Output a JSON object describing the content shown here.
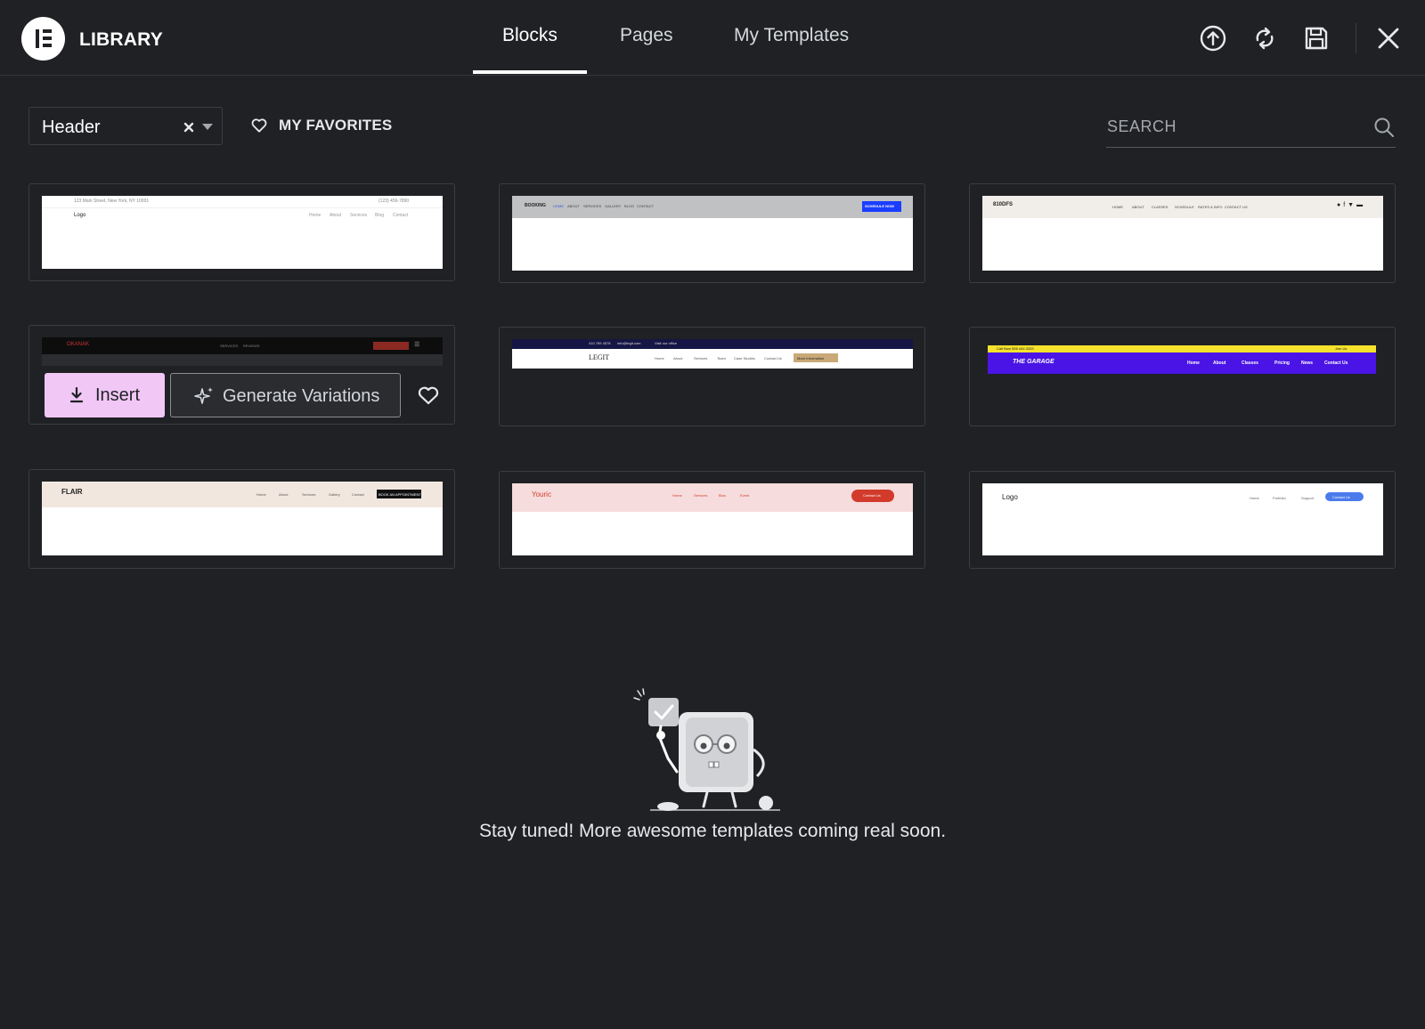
{
  "header": {
    "title": "LIBRARY",
    "tabs": [
      {
        "label": "Blocks",
        "active": true
      },
      {
        "label": "Pages",
        "active": false
      },
      {
        "label": "My Templates",
        "active": false
      }
    ],
    "icons": [
      "upload-icon",
      "sync-icon",
      "save-icon",
      "close-icon"
    ]
  },
  "filters": {
    "category_value": "Header",
    "favorites_label": "MY FAVORITES",
    "search_placeholder": "SEARCH"
  },
  "hovered_card": {
    "insert_label": "Insert",
    "generate_label": "Generate Variations"
  },
  "thumbnails": {
    "t1": {
      "top_text": "123 Main Street, New York, NY 10001",
      "phone": "(123) 456-7890",
      "logo": "Logo",
      "nav": [
        "Home",
        "About",
        "Services",
        "Blog",
        "Contact"
      ]
    },
    "t2": {
      "logo": "BOOKING",
      "nav": [
        "HOME",
        "ABOUT",
        "SERVICES",
        "GALLERY",
        "BLOG",
        "CONTACT"
      ],
      "cta": "SCHEDULE NOW"
    },
    "t3": {
      "logo": "810DFS",
      "nav": [
        "HOME",
        "ABOUT",
        "CLASSES",
        "SCHEDULE",
        "RATES & INFO",
        "CONTACT US"
      ]
    },
    "t4": {
      "logo": "OKANAK",
      "nav": [
        "SERVICES",
        "REVIEWS"
      ]
    },
    "t5": {
      "logo": "LEGIT",
      "nav": [
        "Home",
        "About",
        "Services",
        "Team",
        "Case Studies",
        "Contact Us"
      ],
      "cta": "More Information",
      "top": [
        "410 789 4578",
        "info@legit.com",
        "Visit our office"
      ]
    },
    "t6": {
      "logo": "THE GARAGE",
      "top": "Call Now 555 444 3333",
      "top_right": "Join Us",
      "nav": [
        "Home",
        "About",
        "Classes",
        "Pricing",
        "News",
        "Contact Us"
      ]
    },
    "t7": {
      "logo": "FLAIR",
      "nav": [
        "Home",
        "About",
        "Services",
        "Gallery",
        "Contact"
      ],
      "cta": "BOOK AN APPOINTMENT"
    },
    "t8": {
      "logo": "Youric",
      "nav": [
        "Home",
        "Services",
        "Bios",
        "Event"
      ],
      "cta": "Contact Us"
    },
    "t9": {
      "logo": "Logo",
      "nav": [
        "Home",
        "Portfolio",
        "Support"
      ],
      "cta": "Contact Us"
    }
  },
  "empty_state": {
    "message": "Stay tuned! More awesome templates coming real soon."
  },
  "colors": {
    "background": "#1f2124",
    "insert_button": "#f1c7f6",
    "border": "#3a3d42"
  }
}
